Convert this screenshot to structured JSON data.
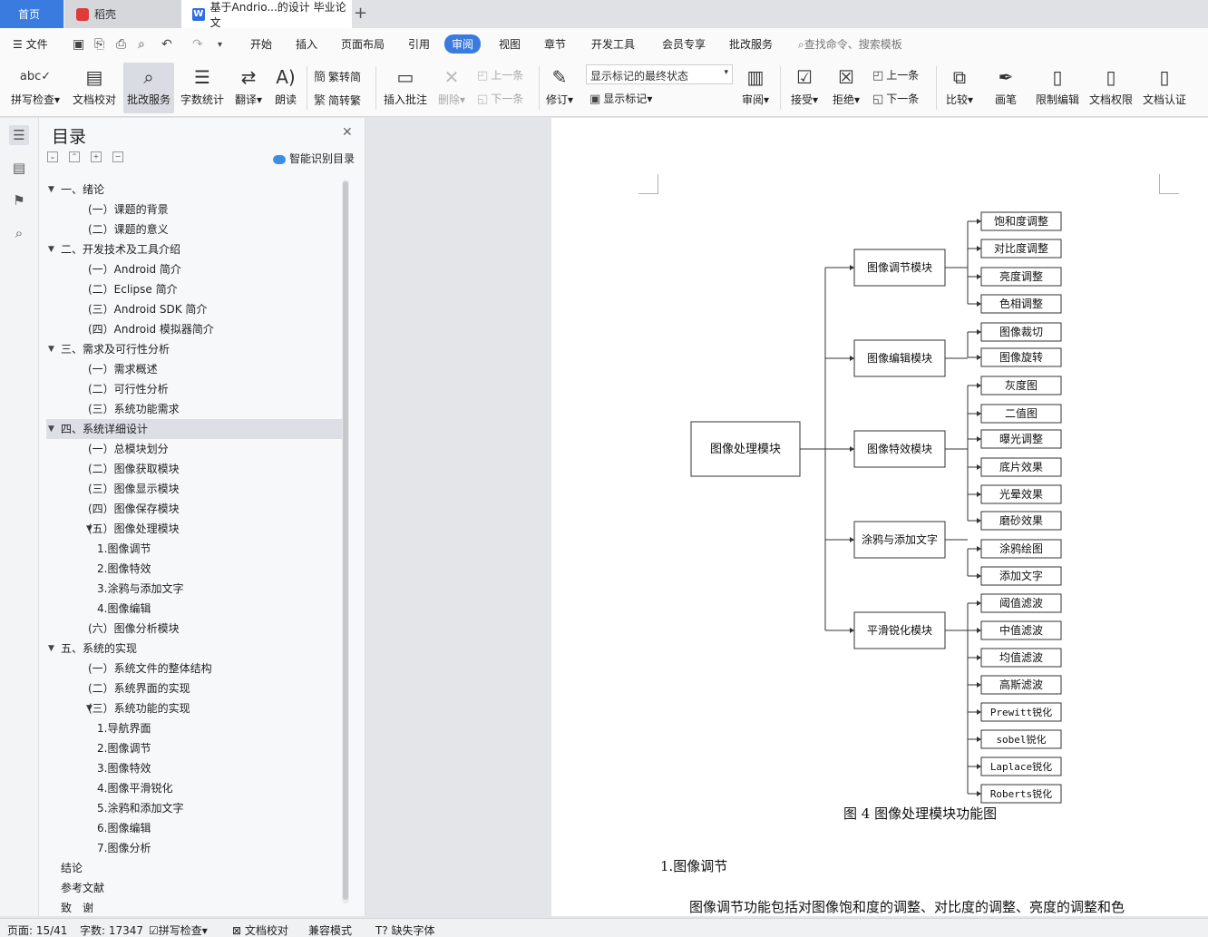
{
  "tabs": {
    "home": "首页",
    "daoke": "稻壳",
    "doc": "基于Andrio...的设计 毕业论文"
  },
  "menu": {
    "file": "文件",
    "items": [
      "开始",
      "插入",
      "页面布局",
      "引用",
      "审阅",
      "视图",
      "章节",
      "开发工具",
      "会员专享",
      "批改服务"
    ],
    "active": "审阅",
    "search": "查找命令、搜索模板"
  },
  "ribbon": {
    "spell": "拼写检查",
    "proof": "文档校对",
    "correct": "批改服务",
    "wordcount": "字数统计",
    "translate": "翻译",
    "read": "朗读",
    "trad2simp": "繁转简",
    "simp2trad": "简转繁",
    "insert_comment": "插入批注",
    "delete": "删除",
    "prev": "上一条",
    "next": "下一条",
    "revise": "修订",
    "markup_state": "显示标记的最终状态",
    "show_markup": "显示标记",
    "review": "审阅",
    "accept": "接受",
    "reject": "拒绝",
    "prev2": "上一条",
    "next2": "下一条",
    "compare": "比较",
    "pen": "画笔",
    "restrict": "限制编辑",
    "permission": "文档权限",
    "certify": "文档认证"
  },
  "toc": {
    "title": "目录",
    "ai": "智能识别目录",
    "items": [
      {
        "text": "一、绪论",
        "level": 0,
        "arrow": true
      },
      {
        "text": "(一）课题的背景",
        "level": 1
      },
      {
        "text": "(二）课题的意义",
        "level": 1
      },
      {
        "text": "二、开发技术及工具介绍",
        "level": 0,
        "arrow": true
      },
      {
        "text": "(一）Android 简介",
        "level": 1
      },
      {
        "text": "(二）Eclipse 简介",
        "level": 1
      },
      {
        "text": "(三）Android SDK 简介",
        "level": 1
      },
      {
        "text": "(四）Android 模拟器简介",
        "level": 1
      },
      {
        "text": "三、需求及可行性分析",
        "level": 0,
        "arrow": true
      },
      {
        "text": "(一）需求概述",
        "level": 1
      },
      {
        "text": "(二）可行性分析",
        "level": 1
      },
      {
        "text": "(三）系统功能需求",
        "level": 1
      },
      {
        "text": "四、系统详细设计",
        "level": 0,
        "arrow": true,
        "selected": true
      },
      {
        "text": "(一）总模块划分",
        "level": 1
      },
      {
        "text": "(二）图像获取模块",
        "level": 1
      },
      {
        "text": "(三）图像显示模块",
        "level": 1
      },
      {
        "text": "(四）图像保存模块",
        "level": 1
      },
      {
        "text": "(五）图像处理模块",
        "level": 1,
        "arrow": true
      },
      {
        "text": "1.图像调节",
        "level": 2
      },
      {
        "text": "2.图像特效",
        "level": 2
      },
      {
        "text": "3.涂鸦与添加文字",
        "level": 2
      },
      {
        "text": "4.图像编辑",
        "level": 2
      },
      {
        "text": "(六）图像分析模块",
        "level": 1
      },
      {
        "text": "五、系统的实现",
        "level": 0,
        "arrow": true
      },
      {
        "text": "(一）系统文件的整体结构",
        "level": 1
      },
      {
        "text": "(二）系统界面的实现",
        "level": 1
      },
      {
        "text": "(三）系统功能的实现",
        "level": 1,
        "arrow": true
      },
      {
        "text": "1.导航界面",
        "level": 2
      },
      {
        "text": "2.图像调节",
        "level": 2
      },
      {
        "text": "3.图像特效",
        "level": 2
      },
      {
        "text": "4.图像平滑锐化",
        "level": 2
      },
      {
        "text": "5.涂鸦和添加文字",
        "level": 2
      },
      {
        "text": "6.图像编辑",
        "level": 2
      },
      {
        "text": "7.图像分析",
        "level": 2
      },
      {
        "text": "结论",
        "level": 0
      },
      {
        "text": "参考文献",
        "level": 0
      },
      {
        "text": "致　谢",
        "level": 0
      }
    ]
  },
  "diagram": {
    "root": "图像处理模块",
    "modules": [
      {
        "name": "图像调节模块",
        "children": [
          "饱和度调整",
          "对比度调整",
          "亮度调整",
          "色相调整"
        ]
      },
      {
        "name": "图像编辑模块",
        "children": [
          "图像裁切",
          "图像旋转"
        ]
      },
      {
        "name": "图像特效模块",
        "children": [
          "灰度图",
          "二值图",
          "曝光调整",
          "底片效果",
          "光晕效果",
          "磨砂效果"
        ]
      },
      {
        "name": "涂鸦与添加文字",
        "children": [
          "涂鸦绘图",
          "添加文字"
        ]
      },
      {
        "name": "平滑锐化模块",
        "children": [
          "阈值滤波",
          "中值滤波",
          "均值滤波",
          "高斯滤波",
          "Prewitt锐化",
          "sobel锐化",
          "Laplace锐化",
          "Roberts锐化"
        ]
      }
    ]
  },
  "doc": {
    "caption": "图 4  图像处理模块功能图",
    "heading": "1.图像调节",
    "paragraph": "图像调节功能包括对图像饱和度的调整、对比度的调整、亮度的调整和色"
  },
  "status": {
    "page": "页面: 15/41",
    "words": "字数: 17347",
    "spell": "拼写检查",
    "proof": "文档校对",
    "compat": "兼容模式",
    "missing_font": "缺失字体"
  }
}
